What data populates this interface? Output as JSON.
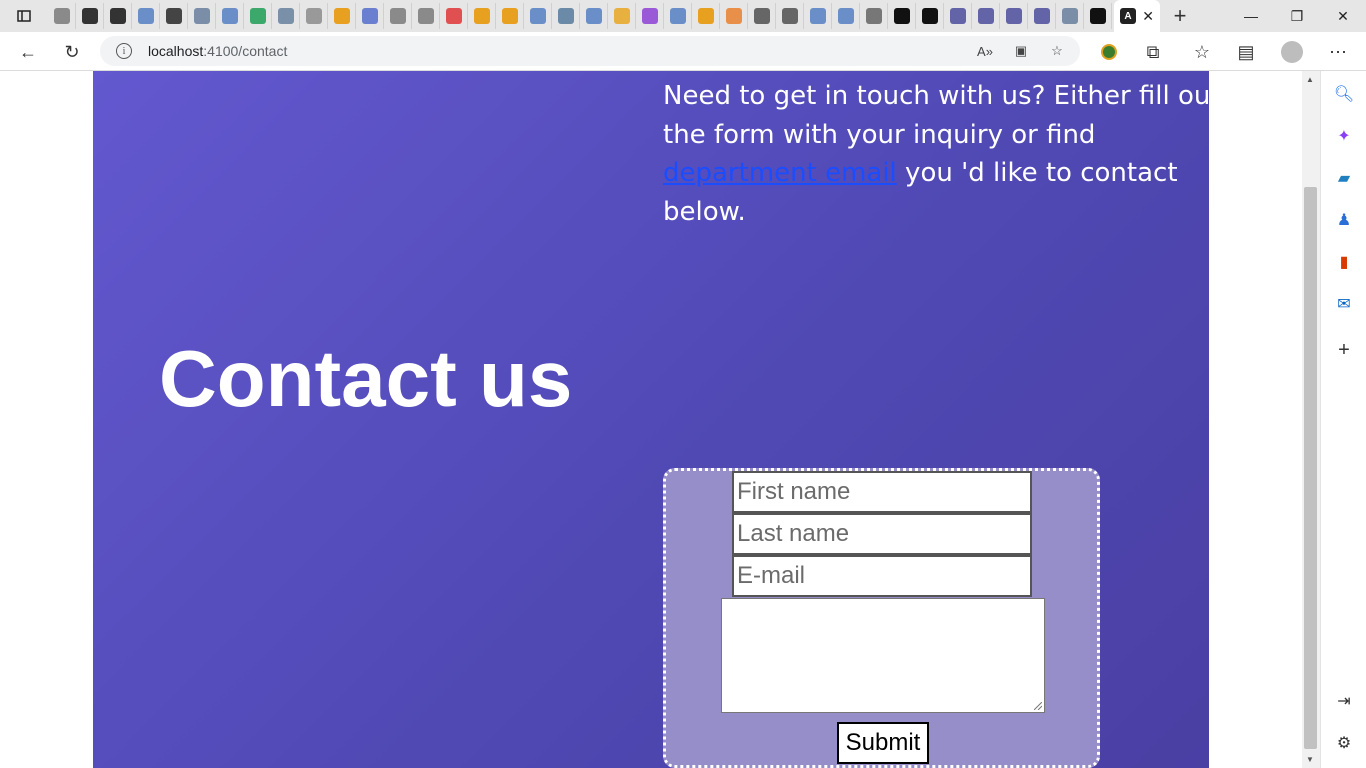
{
  "browser": {
    "url_host": "localhost",
    "url_path": ":4100/contact",
    "info_icon": "i",
    "tabs_count_icons": [
      "doc",
      "github",
      "github",
      "search",
      "dev",
      "edge",
      "search",
      "T",
      "b",
      "link",
      "ms",
      "cut",
      "doc",
      "doc",
      "youtube",
      "ms",
      "ms",
      "search",
      "1M",
      "search",
      "star",
      "B",
      "search",
      "ms",
      "pattern",
      "A",
      "A",
      "search",
      "search",
      "grid",
      "angular",
      "angular",
      "teams",
      "teams",
      "teams",
      "teams",
      "edge",
      "angular"
    ]
  },
  "page": {
    "intro_before": "Need to get in touch with us? Either fill out the form with your inquiry or find ",
    "intro_link": "department email",
    "intro_after": " you 'd like to contact below.",
    "title": "Contact us",
    "form": {
      "first_name_placeholder": "First name",
      "last_name_placeholder": "Last name",
      "email_placeholder": "E-mail",
      "submit_label": "Submit"
    }
  },
  "colors": {
    "hero_start": "#6358cf",
    "hero_end": "#4a3fa3",
    "form_bg": "#958ec8",
    "link": "#1a4dff"
  }
}
